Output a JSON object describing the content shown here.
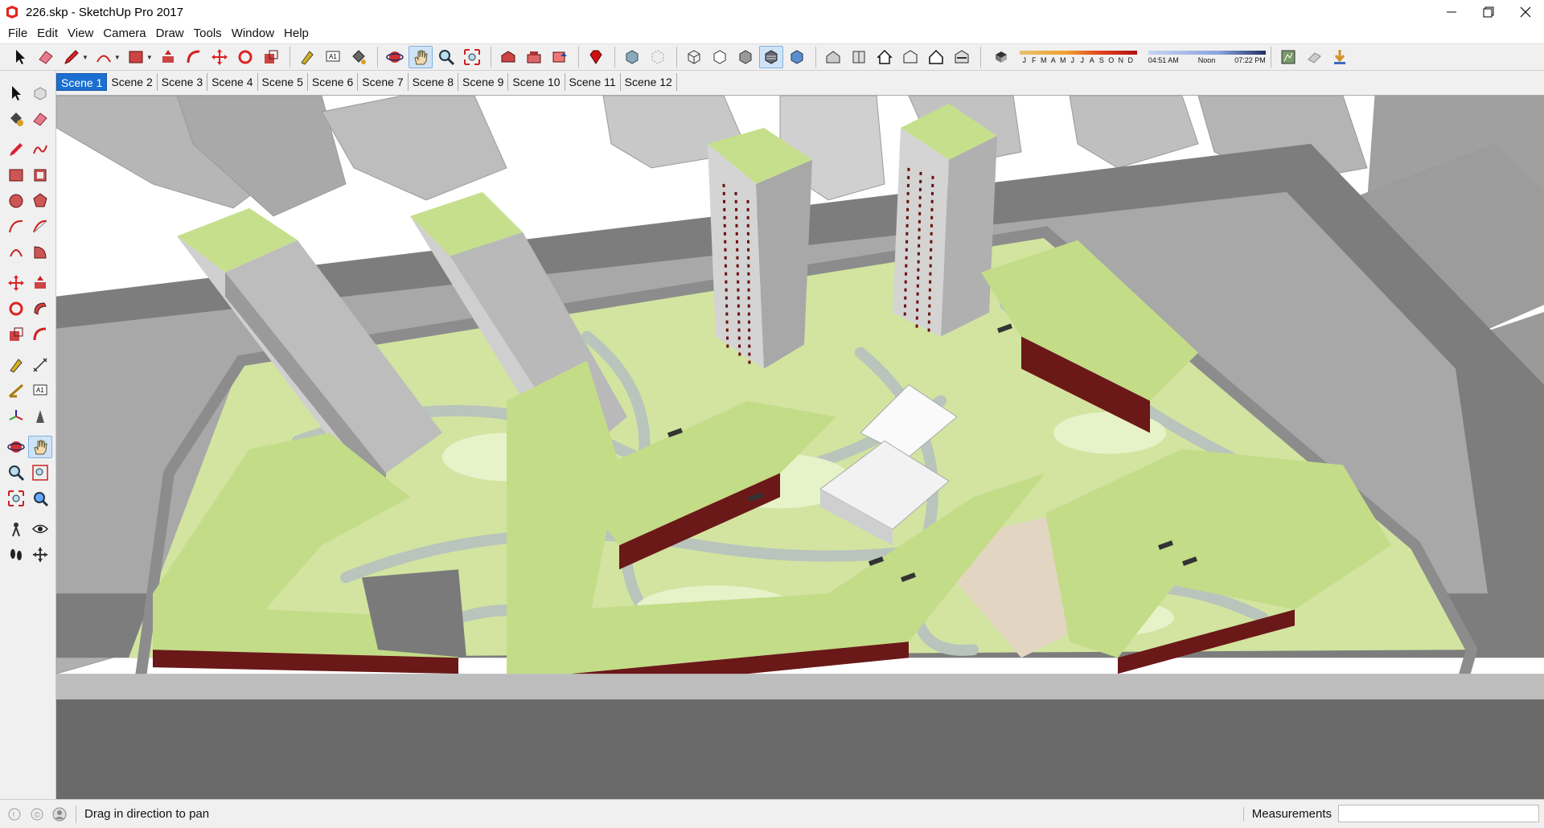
{
  "window": {
    "title": "226.skp - SketchUp Pro 2017",
    "controls": [
      "minimize",
      "restore",
      "close"
    ]
  },
  "menu": [
    "File",
    "Edit",
    "View",
    "Camera",
    "Draw",
    "Tools",
    "Window",
    "Help"
  ],
  "toolbar": {
    "shadow_months": [
      "J",
      "F",
      "M",
      "A",
      "M",
      "J",
      "J",
      "A",
      "S",
      "O",
      "N",
      "D"
    ],
    "sunrise": "04:51 AM",
    "noon": "Noon",
    "sunset": "07:22 PM",
    "active_tool": "pan"
  },
  "scenes": [
    "Scene 1",
    "Scene 2",
    "Scene 3",
    "Scene 4",
    "Scene 5",
    "Scene 6",
    "Scene 7",
    "Scene 8",
    "Scene 9",
    "Scene 10",
    "Scene 11",
    "Scene 12"
  ],
  "active_scene": "Scene 1",
  "status": {
    "message": "Drag in direction to pan",
    "measurements_label": "Measurements",
    "measurements_value": ""
  },
  "colors": {
    "accent": "#1a6fd0",
    "lawn": "#d7eba8",
    "road": "#6e6e6e",
    "building_gray": "#b9b9b9",
    "facade_red": "#6b1010"
  }
}
